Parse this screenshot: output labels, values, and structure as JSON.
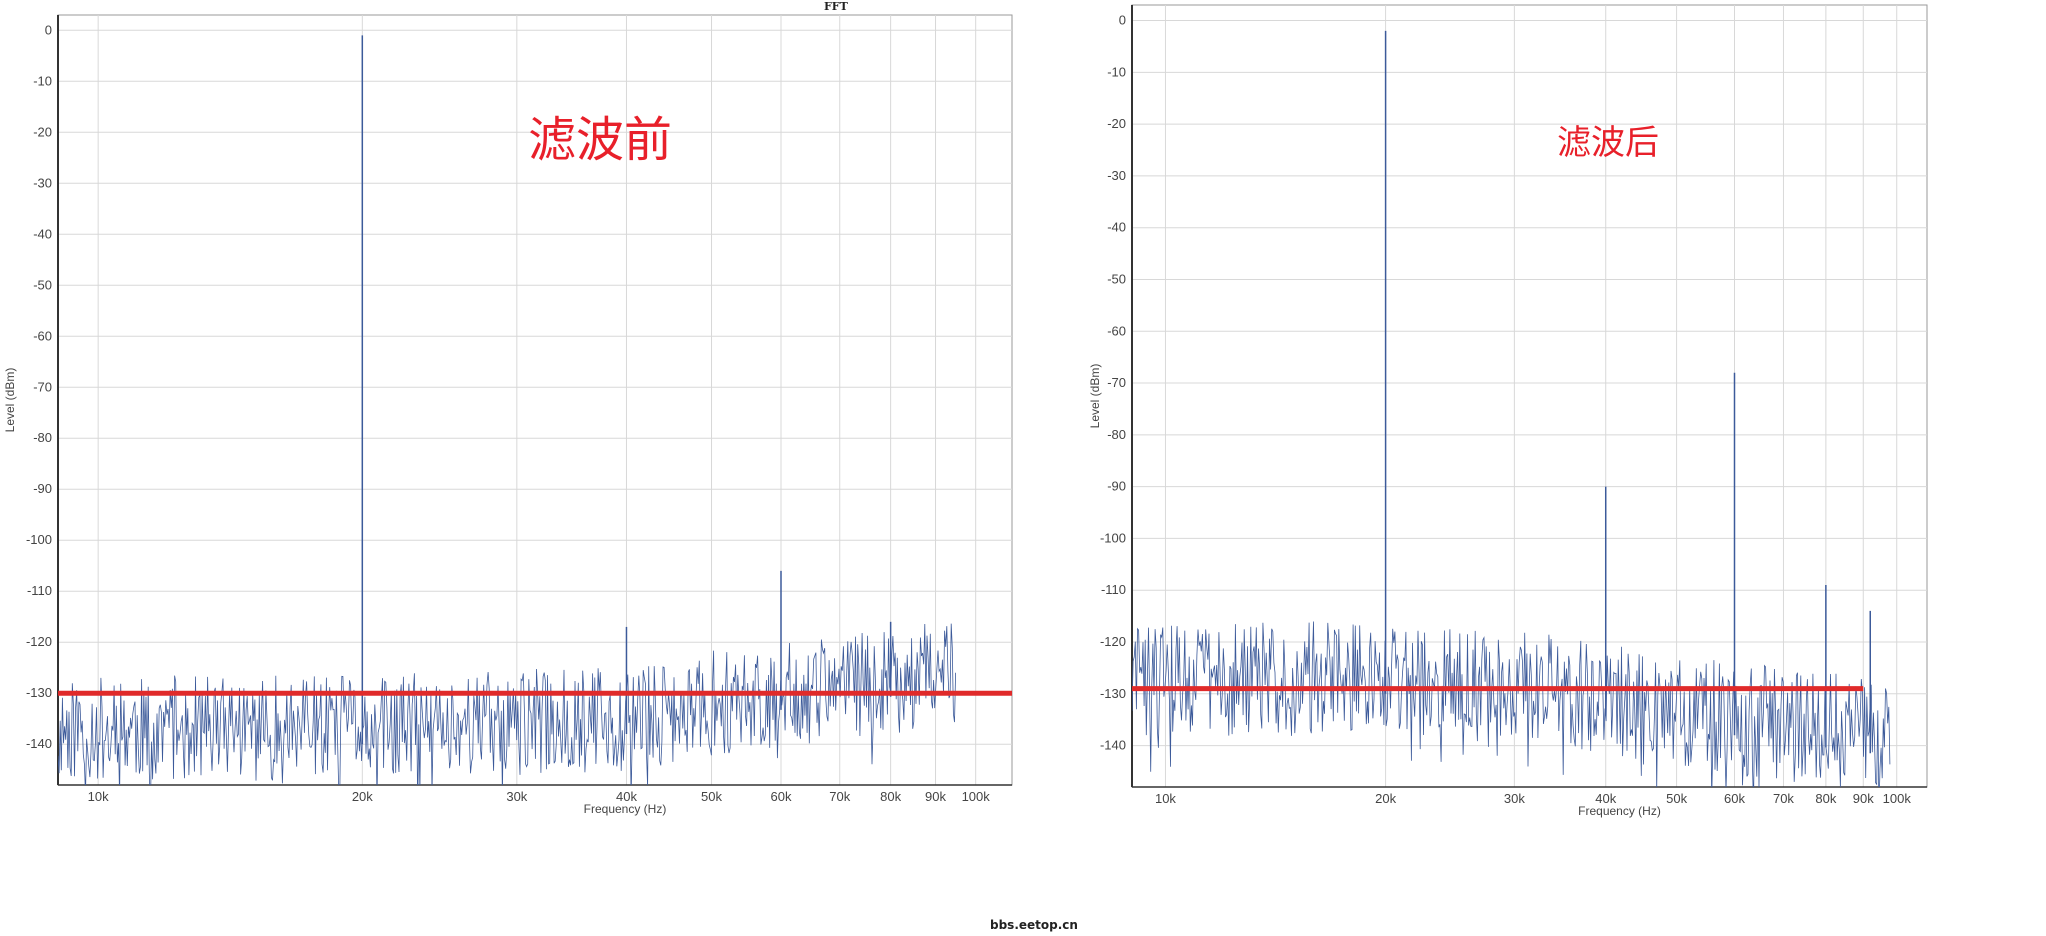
{
  "header": {
    "fft": "FFT"
  },
  "watermark": "bbs.eetop.cn",
  "chart_data": [
    {
      "type": "line",
      "annotation": "滤波前",
      "title": "",
      "xlabel": "Frequency (Hz)",
      "ylabel": "Level (dBm)",
      "xscale": "log",
      "xlim": [
        9000,
        110000
      ],
      "ylim": [
        -148,
        3
      ],
      "xticks": [
        10000,
        20000,
        30000,
        40000,
        50000,
        60000,
        70000,
        80000,
        90000,
        100000
      ],
      "xtick_labels": [
        "10k",
        "20k",
        "30k",
        "40k",
        "50k",
        "60k",
        "70k",
        "80k",
        "90k",
        "100k"
      ],
      "yticks": [
        0,
        -10,
        -20,
        -30,
        -40,
        -50,
        -60,
        -70,
        -80,
        -90,
        -100,
        -110,
        -120,
        -130,
        -140
      ],
      "ytick_labels": [
        "0",
        "-10",
        "-20",
        "-30",
        "-40",
        "-50",
        "-60",
        "-70",
        "-80",
        "-90",
        "-100",
        "-110",
        "-120",
        "-130",
        "-140"
      ],
      "grid": true,
      "series_color": "#3c5a9a",
      "noise_floor": [
        {
          "x": 9000,
          "y": -140
        },
        {
          "x": 20000,
          "y": -140
        },
        {
          "x": 40000,
          "y": -138
        },
        {
          "x": 55000,
          "y": -134
        },
        {
          "x": 70000,
          "y": -132
        },
        {
          "x": 95000,
          "y": -129
        }
      ],
      "noise_span": 13,
      "noise_end": 95000,
      "peaks": [
        {
          "x": 20000,
          "y": -1
        },
        {
          "x": 40000,
          "y": -117
        },
        {
          "x": 60000,
          "y": -106
        },
        {
          "x": 80000,
          "y": -116
        }
      ],
      "reference_line": {
        "y": -130,
        "color": "#e02a2a",
        "x_end": 110000
      }
    },
    {
      "type": "line",
      "annotation": "滤波后",
      "title": "",
      "xlabel": "Frequency (Hz)",
      "ylabel": "Level (dBm)",
      "xscale": "log",
      "xlim": [
        9000,
        110000
      ],
      "ylim": [
        -148,
        3
      ],
      "xticks": [
        10000,
        20000,
        30000,
        40000,
        50000,
        60000,
        70000,
        80000,
        90000,
        100000
      ],
      "xtick_labels": [
        "10k",
        "20k",
        "30k",
        "40k",
        "50k",
        "60k",
        "70k",
        "80k",
        "90k",
        "100k"
      ],
      "yticks": [
        0,
        -10,
        -20,
        -30,
        -40,
        -50,
        -60,
        -70,
        -80,
        -90,
        -100,
        -110,
        -120,
        -130,
        -140
      ],
      "ytick_labels": [
        "0",
        "-10",
        "-20",
        "-30",
        "-40",
        "-50",
        "-60",
        "-70",
        "-80",
        "-90",
        "-100",
        "-110",
        "-120",
        "-130",
        "-140"
      ],
      "grid": true,
      "series_color": "#3c5a9a",
      "noise_floor": [
        {
          "x": 9000,
          "y": -131
        },
        {
          "x": 20000,
          "y": -130
        },
        {
          "x": 35000,
          "y": -133
        },
        {
          "x": 60000,
          "y": -138
        },
        {
          "x": 98000,
          "y": -142
        }
      ],
      "noise_span": 14,
      "noise_end": 98000,
      "peaks": [
        {
          "x": 20000,
          "y": -2
        },
        {
          "x": 40000,
          "y": -90
        },
        {
          "x": 60000,
          "y": -68
        },
        {
          "x": 80000,
          "y": -109
        },
        {
          "x": 92000,
          "y": -114
        }
      ],
      "reference_line": {
        "y": -129,
        "color": "#e02a2a",
        "x_end": 90000
      }
    }
  ]
}
